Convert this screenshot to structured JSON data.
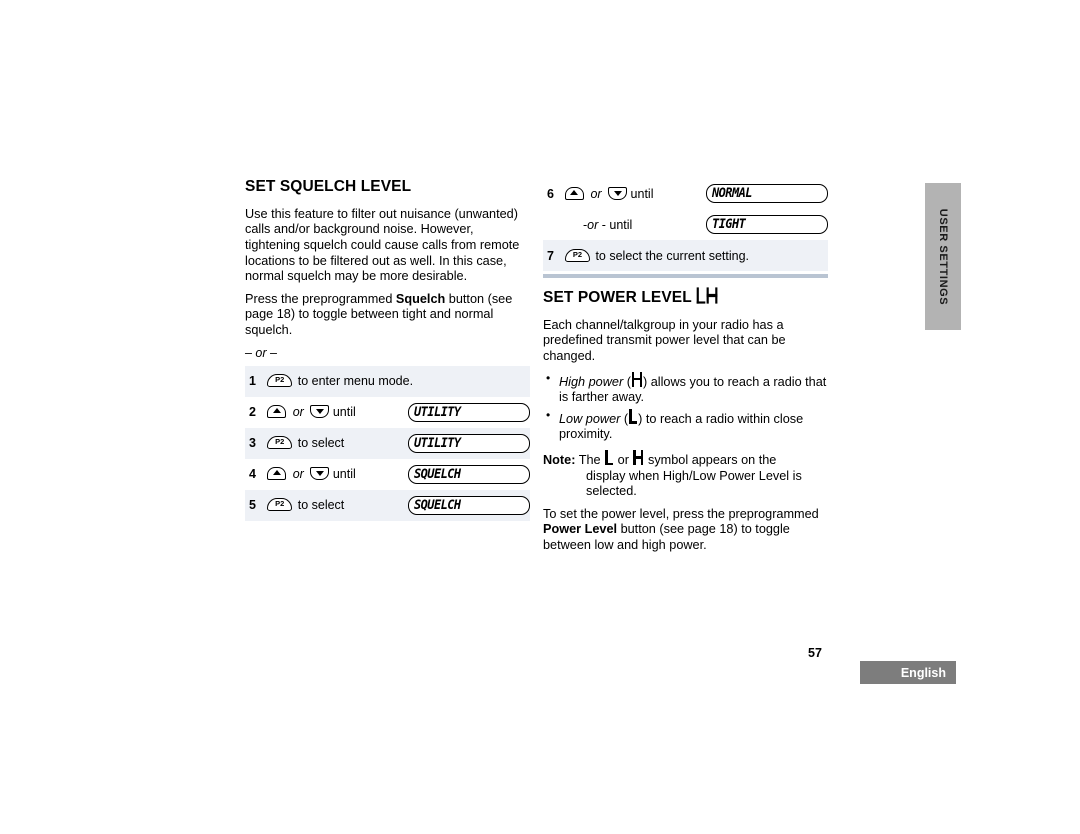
{
  "document": {
    "page_number": "57",
    "language_tab": "English",
    "side_tab": "USER SETTINGS"
  },
  "colors": {
    "side_tab_gray": "#b3b3b3",
    "language_box_gray": "#7d7d7d",
    "row_shade": "#eef1f6",
    "separator_bar": "#b9c4d2"
  },
  "left_column": {
    "title": "SET SQUELCH LEVEL",
    "paragraph_1": "Use this feature to filter out nuisance (unwanted) calls and/or background noise. However, tightening squelch could cause calls from remote locations to be filtered out as well. In this case, normal squelch may be more desirable.",
    "paragraph_2_pre": "Press the preprogrammed ",
    "paragraph_2_bold": "Squelch",
    "paragraph_2_post": " button (see page 18) to toggle between tight and normal squelch.",
    "or_separator": "– or –",
    "steps": [
      {
        "number": "1",
        "icon": "p2-button-icon",
        "icon_label": "P2",
        "action": "to enter menu mode.",
        "display": "",
        "shaded": true
      },
      {
        "number": "2",
        "icon": "up-down-arrow-icon",
        "action_pre": "",
        "or_word": "or",
        "action": "until",
        "display": "UTILITY",
        "shaded": false
      },
      {
        "number": "3",
        "icon": "p2-button-icon",
        "icon_label": "P2",
        "action": "to select",
        "display": "UTILITY",
        "shaded": true
      },
      {
        "number": "4",
        "icon": "up-down-arrow-icon",
        "or_word": "or",
        "action": "until",
        "display": "SQUELCH",
        "shaded": false
      },
      {
        "number": "5",
        "icon": "p2-button-icon",
        "icon_label": "P2",
        "action": "to select",
        "display": "SQUELCH",
        "shaded": true
      }
    ]
  },
  "right_column": {
    "steps": [
      {
        "number": "6",
        "icon": "up-down-arrow-icon",
        "or_word": "or",
        "action": "until",
        "display": "NORMAL",
        "shaded": false
      },
      {
        "number": "",
        "or_line_pre": "-",
        "or_line_italic": "or",
        "or_line_post": " - until",
        "display": "TIGHT",
        "shaded": false
      },
      {
        "number": "7",
        "icon": "p2-button-icon",
        "icon_label": "P2",
        "action": "to select the current setting.",
        "display": "",
        "shaded": true
      }
    ],
    "title": "SET POWER LEVEL",
    "title_symbols": [
      "L",
      "H"
    ],
    "paragraph_1": "Each channel/talkgroup in your radio has a predefined transmit power level that can be changed.",
    "bullets": [
      {
        "italic": "High power",
        "symbol": "H",
        "text": " allows you to reach a radio that is farther away."
      },
      {
        "italic": "Low power",
        "symbol": "L",
        "text": " to reach a radio within close proximity."
      }
    ],
    "note_label": "Note:",
    "note_pre": " The ",
    "note_sym_1": "L",
    "note_mid": " or ",
    "note_sym_2": "H",
    "note_post": " symbol appears on the",
    "note_line_2": "display when High/Low Power Level is",
    "note_line_3": "selected.",
    "paragraph_2_pre": "To set the power level, press the preprogrammed ",
    "paragraph_2_bold": "Power Level",
    "paragraph_2_post": " button (see page 18) to toggle between low and high power."
  }
}
